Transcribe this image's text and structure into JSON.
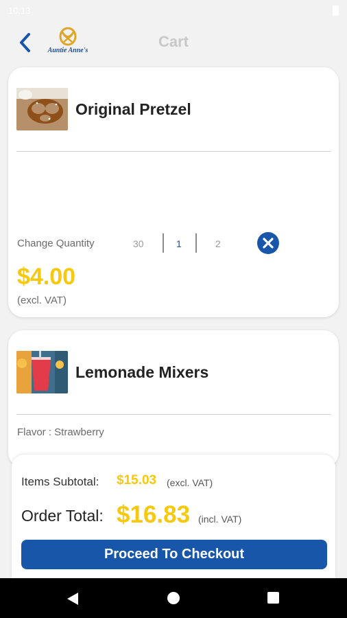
{
  "status_bar": {
    "time": "10:13"
  },
  "header": {
    "title": "Cart",
    "logo_text": "Auntie Anne's"
  },
  "cart_items": [
    {
      "name": "Original Pretzel",
      "quantity_label": "Change Quantity",
      "quantity_prev": "30",
      "quantity_current": "1",
      "quantity_next": "2",
      "price": "$4.00",
      "price_note": "(excl. VAT)"
    },
    {
      "name": "Lemonade Mixers",
      "flavor": "Flavor : Strawberry"
    }
  ],
  "summary": {
    "subtotal_label": "Items Subtotal:",
    "subtotal_value": "$15.03",
    "subtotal_note": "(excl. VAT)",
    "total_label": "Order Total:",
    "total_value": "$16.83",
    "total_note": "(incl. VAT)",
    "checkout_label": "Proceed To Checkout"
  },
  "colors": {
    "accent_blue": "#1756a8",
    "price_yellow": "#f6c80e"
  }
}
